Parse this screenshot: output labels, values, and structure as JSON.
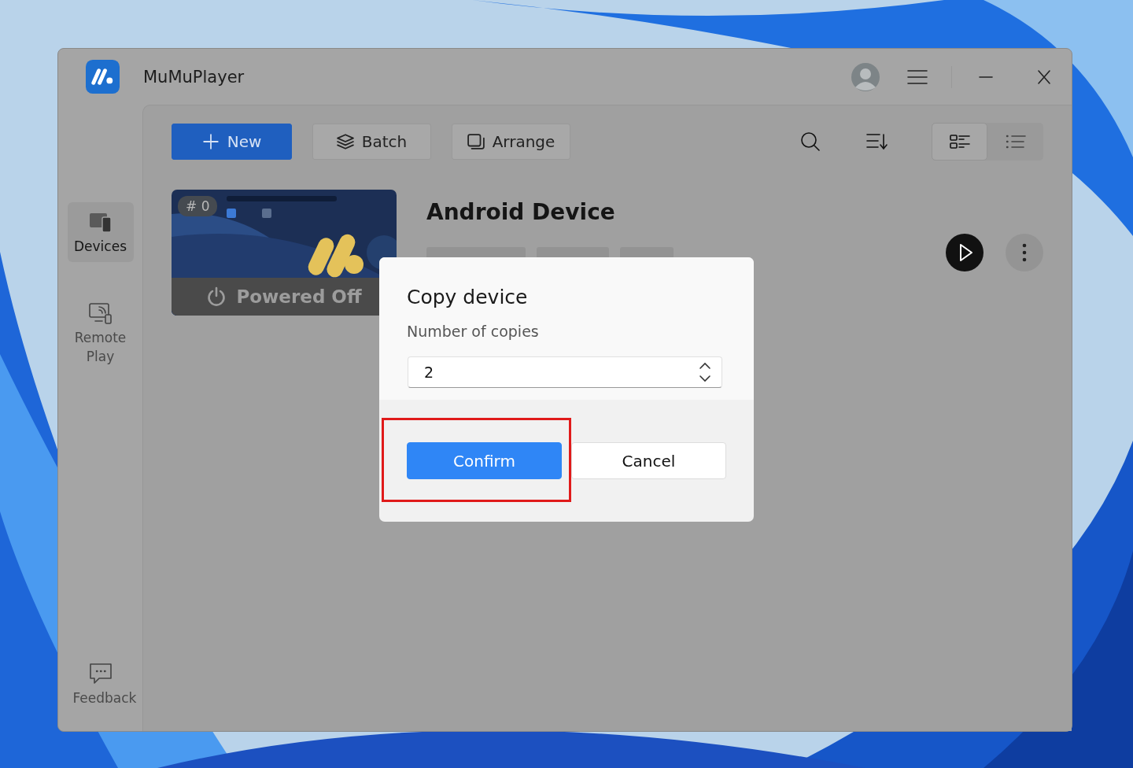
{
  "window": {
    "title": "MuMuPlayer"
  },
  "sidebar": {
    "items": [
      {
        "label": "Devices",
        "kind": "devices",
        "selected": true
      },
      {
        "label": "Remote Play",
        "kind": "remote",
        "selected": false
      }
    ],
    "footer": {
      "label": "Feedback"
    }
  },
  "toolbar": {
    "buttons": [
      {
        "label": "New",
        "kind": "primary"
      },
      {
        "label": "Batch",
        "kind": "batch"
      },
      {
        "label": "Arrange",
        "kind": "arrange"
      }
    ],
    "view_modes": [
      {
        "kind": "cards",
        "selected": true
      },
      {
        "kind": "list",
        "selected": false
      }
    ]
  },
  "device": {
    "index": "# 0",
    "status": "Powered Off",
    "name": "Android Device"
  },
  "dialog": {
    "title": "Copy device",
    "label": "Number of copies",
    "value": "2",
    "buttons": [
      {
        "label": "Confirm",
        "kind": "primary",
        "highlighted": true
      },
      {
        "label": "Cancel",
        "kind": "secondary",
        "highlighted": false
      }
    ]
  }
}
